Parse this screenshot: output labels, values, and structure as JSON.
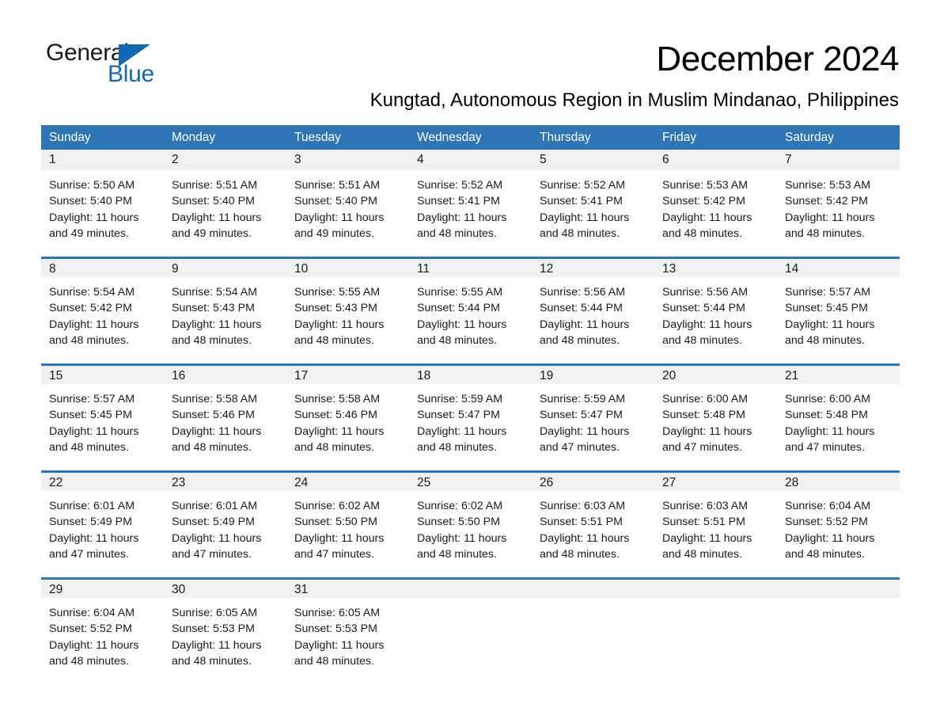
{
  "brand": {
    "name_part1": "General",
    "name_part2": "Blue",
    "triangle_color": "#1268b3"
  },
  "header": {
    "month_title": "December 2024",
    "location": "Kungtad, Autonomous Region in Muslim Mindanao, Philippines"
  },
  "colors": {
    "header_blue": "#2e75b6",
    "daynum_gray": "#f1f1f1",
    "text": "#1a1a1a",
    "header_text": "#ffffff"
  },
  "weekdays": [
    "Sunday",
    "Monday",
    "Tuesday",
    "Wednesday",
    "Thursday",
    "Friday",
    "Saturday"
  ],
  "weeks": [
    {
      "days": [
        {
          "num": "1",
          "sunrise": "Sunrise: 5:50 AM",
          "sunset": "Sunset: 5:40 PM",
          "daylight1": "Daylight: 11 hours",
          "daylight2": "and 49 minutes."
        },
        {
          "num": "2",
          "sunrise": "Sunrise: 5:51 AM",
          "sunset": "Sunset: 5:40 PM",
          "daylight1": "Daylight: 11 hours",
          "daylight2": "and 49 minutes."
        },
        {
          "num": "3",
          "sunrise": "Sunrise: 5:51 AM",
          "sunset": "Sunset: 5:40 PM",
          "daylight1": "Daylight: 11 hours",
          "daylight2": "and 49 minutes."
        },
        {
          "num": "4",
          "sunrise": "Sunrise: 5:52 AM",
          "sunset": "Sunset: 5:41 PM",
          "daylight1": "Daylight: 11 hours",
          "daylight2": "and 48 minutes."
        },
        {
          "num": "5",
          "sunrise": "Sunrise: 5:52 AM",
          "sunset": "Sunset: 5:41 PM",
          "daylight1": "Daylight: 11 hours",
          "daylight2": "and 48 minutes."
        },
        {
          "num": "6",
          "sunrise": "Sunrise: 5:53 AM",
          "sunset": "Sunset: 5:42 PM",
          "daylight1": "Daylight: 11 hours",
          "daylight2": "and 48 minutes."
        },
        {
          "num": "7",
          "sunrise": "Sunrise: 5:53 AM",
          "sunset": "Sunset: 5:42 PM",
          "daylight1": "Daylight: 11 hours",
          "daylight2": "and 48 minutes."
        }
      ]
    },
    {
      "days": [
        {
          "num": "8",
          "sunrise": "Sunrise: 5:54 AM",
          "sunset": "Sunset: 5:42 PM",
          "daylight1": "Daylight: 11 hours",
          "daylight2": "and 48 minutes."
        },
        {
          "num": "9",
          "sunrise": "Sunrise: 5:54 AM",
          "sunset": "Sunset: 5:43 PM",
          "daylight1": "Daylight: 11 hours",
          "daylight2": "and 48 minutes."
        },
        {
          "num": "10",
          "sunrise": "Sunrise: 5:55 AM",
          "sunset": "Sunset: 5:43 PM",
          "daylight1": "Daylight: 11 hours",
          "daylight2": "and 48 minutes."
        },
        {
          "num": "11",
          "sunrise": "Sunrise: 5:55 AM",
          "sunset": "Sunset: 5:44 PM",
          "daylight1": "Daylight: 11 hours",
          "daylight2": "and 48 minutes."
        },
        {
          "num": "12",
          "sunrise": "Sunrise: 5:56 AM",
          "sunset": "Sunset: 5:44 PM",
          "daylight1": "Daylight: 11 hours",
          "daylight2": "and 48 minutes."
        },
        {
          "num": "13",
          "sunrise": "Sunrise: 5:56 AM",
          "sunset": "Sunset: 5:44 PM",
          "daylight1": "Daylight: 11 hours",
          "daylight2": "and 48 minutes."
        },
        {
          "num": "14",
          "sunrise": "Sunrise: 5:57 AM",
          "sunset": "Sunset: 5:45 PM",
          "daylight1": "Daylight: 11 hours",
          "daylight2": "and 48 minutes."
        }
      ]
    },
    {
      "days": [
        {
          "num": "15",
          "sunrise": "Sunrise: 5:57 AM",
          "sunset": "Sunset: 5:45 PM",
          "daylight1": "Daylight: 11 hours",
          "daylight2": "and 48 minutes."
        },
        {
          "num": "16",
          "sunrise": "Sunrise: 5:58 AM",
          "sunset": "Sunset: 5:46 PM",
          "daylight1": "Daylight: 11 hours",
          "daylight2": "and 48 minutes."
        },
        {
          "num": "17",
          "sunrise": "Sunrise: 5:58 AM",
          "sunset": "Sunset: 5:46 PM",
          "daylight1": "Daylight: 11 hours",
          "daylight2": "and 48 minutes."
        },
        {
          "num": "18",
          "sunrise": "Sunrise: 5:59 AM",
          "sunset": "Sunset: 5:47 PM",
          "daylight1": "Daylight: 11 hours",
          "daylight2": "and 48 minutes."
        },
        {
          "num": "19",
          "sunrise": "Sunrise: 5:59 AM",
          "sunset": "Sunset: 5:47 PM",
          "daylight1": "Daylight: 11 hours",
          "daylight2": "and 47 minutes."
        },
        {
          "num": "20",
          "sunrise": "Sunrise: 6:00 AM",
          "sunset": "Sunset: 5:48 PM",
          "daylight1": "Daylight: 11 hours",
          "daylight2": "and 47 minutes."
        },
        {
          "num": "21",
          "sunrise": "Sunrise: 6:00 AM",
          "sunset": "Sunset: 5:48 PM",
          "daylight1": "Daylight: 11 hours",
          "daylight2": "and 47 minutes."
        }
      ]
    },
    {
      "days": [
        {
          "num": "22",
          "sunrise": "Sunrise: 6:01 AM",
          "sunset": "Sunset: 5:49 PM",
          "daylight1": "Daylight: 11 hours",
          "daylight2": "and 47 minutes."
        },
        {
          "num": "23",
          "sunrise": "Sunrise: 6:01 AM",
          "sunset": "Sunset: 5:49 PM",
          "daylight1": "Daylight: 11 hours",
          "daylight2": "and 47 minutes."
        },
        {
          "num": "24",
          "sunrise": "Sunrise: 6:02 AM",
          "sunset": "Sunset: 5:50 PM",
          "daylight1": "Daylight: 11 hours",
          "daylight2": "and 47 minutes."
        },
        {
          "num": "25",
          "sunrise": "Sunrise: 6:02 AM",
          "sunset": "Sunset: 5:50 PM",
          "daylight1": "Daylight: 11 hours",
          "daylight2": "and 48 minutes."
        },
        {
          "num": "26",
          "sunrise": "Sunrise: 6:03 AM",
          "sunset": "Sunset: 5:51 PM",
          "daylight1": "Daylight: 11 hours",
          "daylight2": "and 48 minutes."
        },
        {
          "num": "27",
          "sunrise": "Sunrise: 6:03 AM",
          "sunset": "Sunset: 5:51 PM",
          "daylight1": "Daylight: 11 hours",
          "daylight2": "and 48 minutes."
        },
        {
          "num": "28",
          "sunrise": "Sunrise: 6:04 AM",
          "sunset": "Sunset: 5:52 PM",
          "daylight1": "Daylight: 11 hours",
          "daylight2": "and 48 minutes."
        }
      ]
    },
    {
      "days": [
        {
          "num": "29",
          "sunrise": "Sunrise: 6:04 AM",
          "sunset": "Sunset: 5:52 PM",
          "daylight1": "Daylight: 11 hours",
          "daylight2": "and 48 minutes."
        },
        {
          "num": "30",
          "sunrise": "Sunrise: 6:05 AM",
          "sunset": "Sunset: 5:53 PM",
          "daylight1": "Daylight: 11 hours",
          "daylight2": "and 48 minutes."
        },
        {
          "num": "31",
          "sunrise": "Sunrise: 6:05 AM",
          "sunset": "Sunset: 5:53 PM",
          "daylight1": "Daylight: 11 hours",
          "daylight2": "and 48 minutes."
        },
        {
          "num": "",
          "sunrise": "",
          "sunset": "",
          "daylight1": "",
          "daylight2": ""
        },
        {
          "num": "",
          "sunrise": "",
          "sunset": "",
          "daylight1": "",
          "daylight2": ""
        },
        {
          "num": "",
          "sunrise": "",
          "sunset": "",
          "daylight1": "",
          "daylight2": ""
        },
        {
          "num": "",
          "sunrise": "",
          "sunset": "",
          "daylight1": "",
          "daylight2": ""
        }
      ]
    }
  ]
}
